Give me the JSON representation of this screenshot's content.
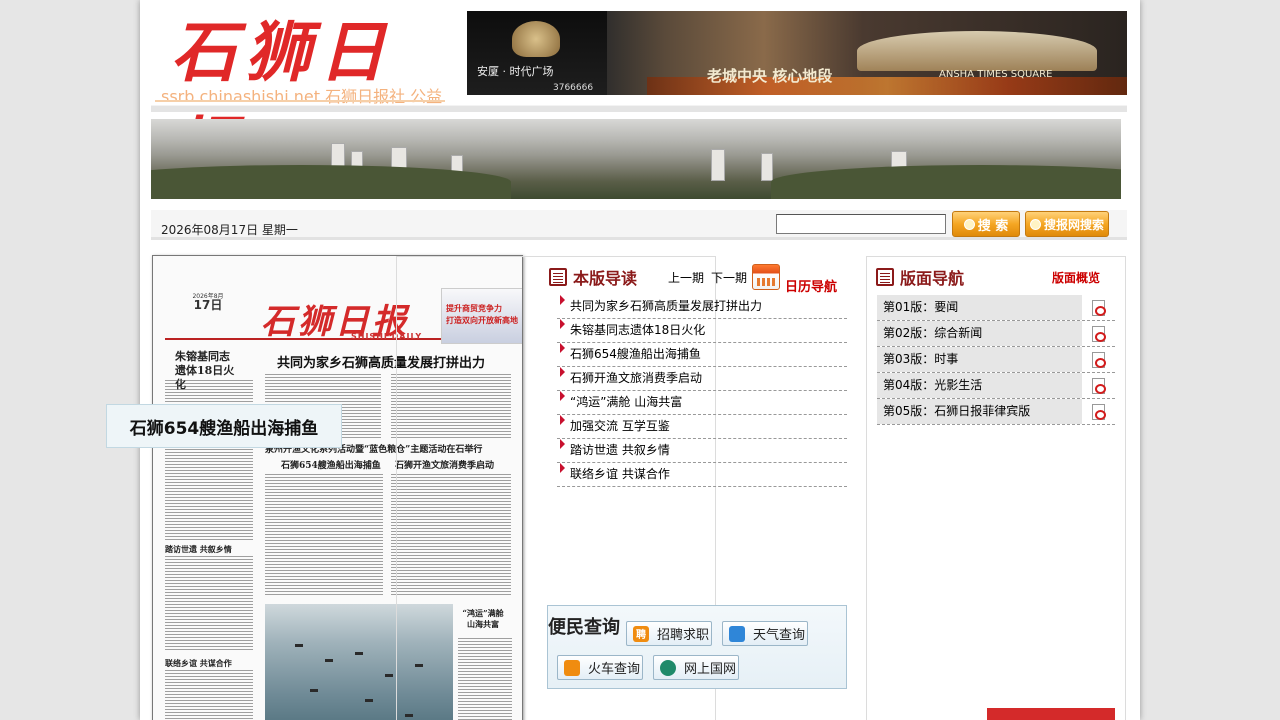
{
  "header": {
    "logo_title": "石狮日报",
    "logo_subtitle": "ssrb.chinashishi.net 石狮日报社.公益",
    "ad_developer": "安厦 · 时代广场",
    "ad_phone": "3766666",
    "ad_slogan": "老城中央 核心地段",
    "ad_slogan_en": "ANSHA TIMES SQUARE"
  },
  "datebar": {
    "date": "2026年08月17日 星期一",
    "search_placeholder": "",
    "search_button": "搜 索",
    "net_search_button": "搜报网搜索"
  },
  "newspaper": {
    "date_month": "2026年8月",
    "date_day": "17日",
    "masthead": "石狮日报",
    "masthead_en": "SHISHI DAILY",
    "ad_line1": "提升商贸竞争力",
    "ad_line2": "打造双向开放新高地",
    "side_title": "朱镕基同志遗体18日火化",
    "lead_headline": "共同为家乡石狮高质量发展打拼出力",
    "topic": "泉州开渔文化系列活动暨“蓝色粮仓”主题活动在石举行",
    "sub_left": "石狮654艘渔船出海捕鱼",
    "sub_right": "石狮开渔文旅消费季启动",
    "side_b1": "踏访世遗 共叙乡情",
    "side_b2": "联络乡谊 共谋合作",
    "side_b3": "“鸿运”满舱 山海共富"
  },
  "tooltip": "石狮654艘渔船出海捕鱼",
  "guide": {
    "title": "本版导读",
    "prev": "上一期",
    "next": "下一期",
    "calendar": "日历导航",
    "stories": [
      "共同为家乡石狮高质量发展打拼出力",
      "朱镕基同志遗体18日火化",
      "石狮654艘渔船出海捕鱼",
      "石狮开渔文旅消费季启动",
      "“鸿运”满舱 山海共富",
      "加强交流 互学互鉴",
      "踏访世遗 共叙乡情",
      "联络乡谊 共谋合作"
    ]
  },
  "services": {
    "title": "便民查询",
    "jobs": "招聘求职",
    "jobs_icon": "聘",
    "weather": "天气查询",
    "train": "火车查询",
    "netgov": "网上国网"
  },
  "pages_nav": {
    "title": "版面导航",
    "overview": "版面概览",
    "pages": [
      "第01版：要闻",
      "第02版：综合新闻",
      "第03版：时事",
      "第04版：光影生活",
      "第05版：石狮日报菲律宾版"
    ]
  },
  "colors": {
    "accent_red": "#8b1a1a",
    "link_red": "#c00000",
    "button_orange": "#f5a623"
  },
  "icons": {
    "guide": "newspaper-icon",
    "pages": "newspaper-icon",
    "calendar": "calendar-icon",
    "pdf": "pdf-icon",
    "bullet": "triangle-bullet-icon"
  }
}
